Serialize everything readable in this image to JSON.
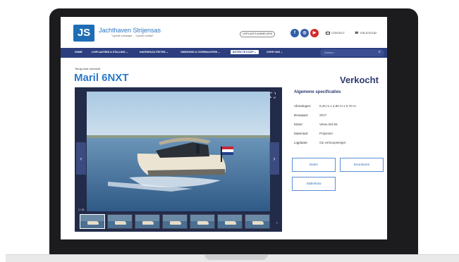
{
  "site": {
    "logo_text": "JS",
    "brand": "Jachthaven Strijensas",
    "tagline": "\"t goede ontvangst ... 't goede contact\"",
    "login_label": "LIGPLAATS AANMELDEN",
    "social": [
      "f",
      "ig",
      "yt"
    ],
    "contact_label": "CONTACT",
    "phone": "078-6742182"
  },
  "nav": {
    "items": [
      {
        "label": "HOME"
      },
      {
        "label": "LIGPLAATSEN & STALLING ⌄"
      },
      {
        "label": "HAVENFACILITEITEN ⌄"
      },
      {
        "label": "OMGEVING & OVERNACHTEN ⌄"
      },
      {
        "label": "BOTEN TE KOOP ⌄",
        "active": true
      },
      {
        "label": "OVER ONS ⌄"
      }
    ],
    "search_placeholder": "Zoeken..."
  },
  "page": {
    "back_link": "Terug naar overzicht",
    "title": "Maril 6NXT",
    "status": "Verkocht"
  },
  "gallery": {
    "counter": "1 / 21",
    "thumb_count": 8
  },
  "specs": {
    "title": "Algemene specificaties",
    "rows": [
      {
        "label": "Afmetingen:",
        "value": "6,40 m x 2,60 m x 0,70 m"
      },
      {
        "label": "Bouwjaar:",
        "value": "2017"
      },
      {
        "label": "Motor:",
        "value": "Vetus M4.56"
      },
      {
        "label": "Materiaal:",
        "value": "Polyester"
      },
      {
        "label": "Ligplaats:",
        "value": "Op verkoopsteiger"
      }
    ]
  },
  "actions": {
    "share": "Delen",
    "forward": "Doorsturen",
    "slideshow": "Slideshow"
  },
  "colors": {
    "nav_bg": "#2c3e7e",
    "accent": "#2a7ac8",
    "status": "#2d3a70"
  }
}
